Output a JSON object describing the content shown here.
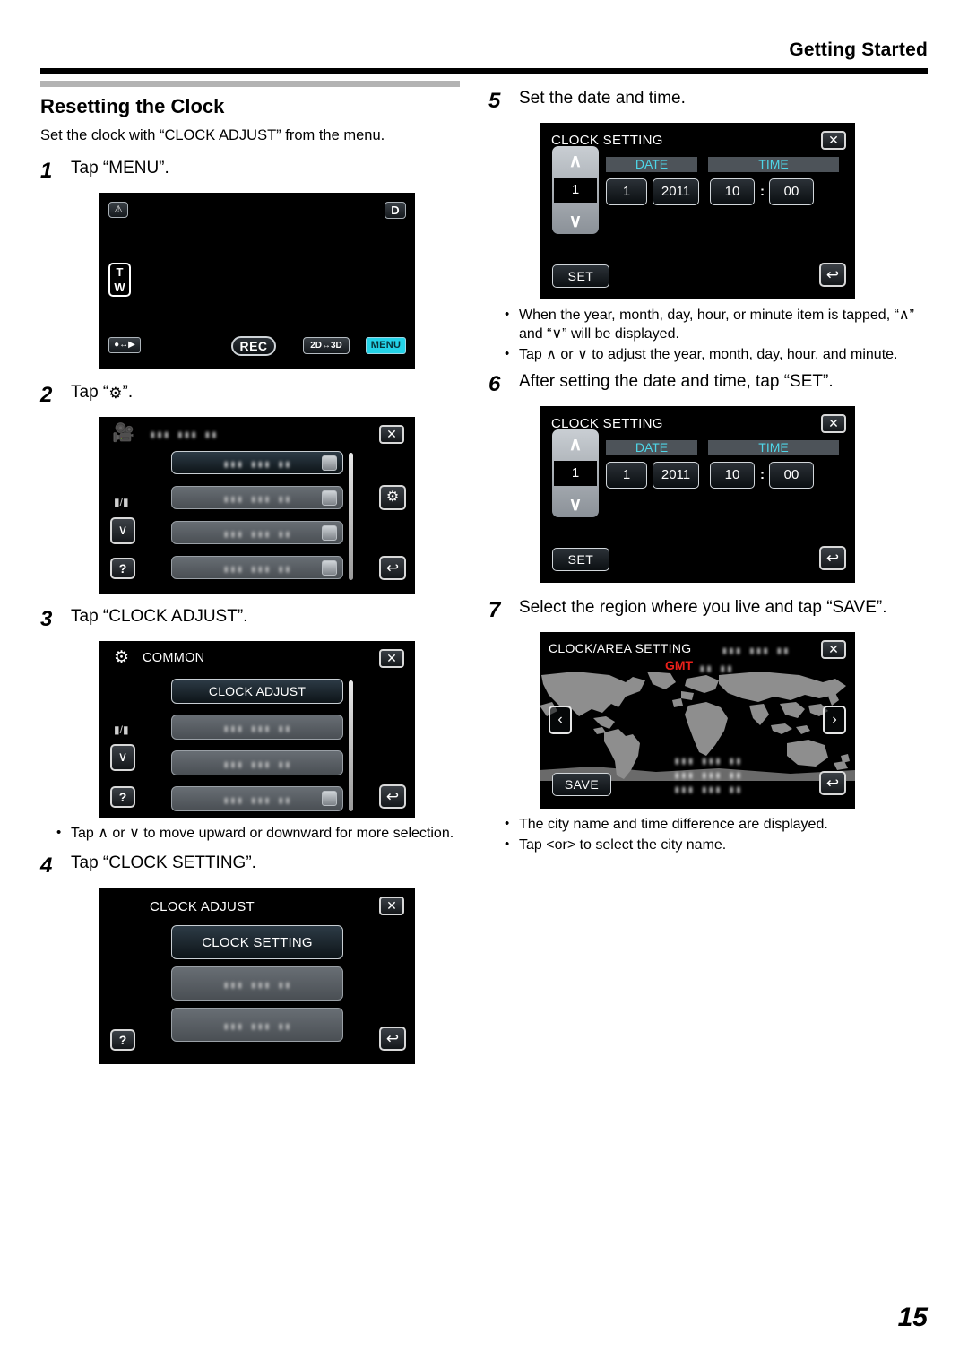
{
  "header": {
    "title": "Getting Started"
  },
  "page_number": "15",
  "section": {
    "title": "Resetting the Clock",
    "lead": "Set the clock with “CLOCK ADJUST” from the menu."
  },
  "steps": [
    {
      "num": "1",
      "text": "Tap “MENU”."
    },
    {
      "num": "2",
      "text_before": "Tap “",
      "icon": "gear-icon",
      "text_after": "”."
    },
    {
      "num": "3",
      "text": "Tap “CLOCK ADJUST”."
    },
    {
      "num": "4",
      "text": "Tap “CLOCK SETTING”."
    },
    {
      "num": "5",
      "text": "Set the date and time."
    },
    {
      "num": "6",
      "text": "After setting the date and time, tap “SET”."
    },
    {
      "num": "7",
      "text": "Select the region where you live and tap “SAVE”."
    }
  ],
  "notes": {
    "step3": [
      "Tap ∧ or ∨ to move upward or downward for more selection."
    ],
    "step5": [
      "When the year, month, day, hour, or minute item is tapped, “∧” and “∨” will be displayed.",
      "Tap ∧ or ∨ to adjust the year, month, day, hour, and minute."
    ],
    "step7": [
      "The city name and time difference are displayed.",
      "Tap <or> to select the city name."
    ]
  },
  "screens": {
    "record": {
      "warning_badge": "⚠",
      "d_badge": "D",
      "zoom_t": "T",
      "zoom_w": "W",
      "mode_switch": "●↔▶",
      "rec_label": "REC",
      "label_2d3d": "2D↔3D",
      "menu_label": "MENU"
    },
    "menu_video": {
      "icon": "camcorder-icon",
      "title_placeholder": "▮▮▮ ▮▮▮ ▮▮",
      "rows": [
        {
          "label": "▮▮▮ ▮▮▮ ▮▮",
          "selected": true,
          "has_switch": true
        },
        {
          "label": "▮▮▮ ▮▮▮ ▮▮",
          "selected": false,
          "has_switch": true
        },
        {
          "label": "▮▮▮ ▮▮▮ ▮▮",
          "selected": false,
          "has_switch": true
        },
        {
          "label": "▮▮▮ ▮▮▮ ▮▮",
          "selected": false,
          "has_switch": true
        }
      ],
      "close": "✕",
      "gear": "⚙",
      "down": "∨",
      "help": "?",
      "back": "↩",
      "media_icon": "▮/▮"
    },
    "menu_common": {
      "icon": "gear-icon",
      "title": "COMMON",
      "rows": [
        {
          "label": "CLOCK ADJUST",
          "selected": true,
          "has_switch": false
        },
        {
          "label": "▮▮▮ ▮▮▮ ▮▮",
          "selected": false,
          "has_switch": false
        },
        {
          "label": "▮▮▮ ▮▮▮ ▮▮",
          "selected": false,
          "has_switch": false
        },
        {
          "label": "▮▮▮ ▮▮▮ ▮▮",
          "selected": false,
          "has_switch": true
        }
      ],
      "close": "✕",
      "down": "∨",
      "help": "?",
      "back": "↩",
      "media_icon": "▮/▮"
    },
    "clock_adjust": {
      "title": "CLOCK ADJUST",
      "rows": [
        {
          "label": "CLOCK SETTING",
          "selected": true
        },
        {
          "label": "▮▮▮ ▮▮▮ ▮▮",
          "selected": false
        },
        {
          "label": "▮▮▮ ▮▮▮ ▮▮",
          "selected": false
        }
      ],
      "close": "✕",
      "help": "?",
      "back": "↩"
    },
    "clock_setting": {
      "title": "CLOCK SETTING",
      "date_header": "DATE",
      "time_header": "TIME",
      "spinner_value": "1",
      "spinner_up": "∧",
      "spinner_down": "∨",
      "month": "1",
      "year": "2011",
      "hour": "10",
      "colon": ":",
      "minute": "00",
      "set_label": "SET",
      "close": "✕",
      "back": "↩"
    },
    "clock_area": {
      "title": "CLOCK/AREA SETTING",
      "title_placeholder": "▮▮▮ ▮▮▮ ▮▮",
      "gmt_label": "GMT",
      "gmt_value": "▮▮ ▮▮",
      "city_lines": [
        "▮▮▮ ▮▮▮ ▮▮",
        "▮▮▮ ▮▮▮ ▮▮",
        "▮▮▮ ▮▮▮ ▮▮"
      ],
      "prev": "‹",
      "next": "›",
      "save_label": "SAVE",
      "close": "✕",
      "back": "↩"
    }
  },
  "colors": {
    "accent_cyan": "#23d3e8",
    "label_cyan": "#4fd6e8",
    "gmt_red": "#e8201a",
    "rule": "#000000",
    "section_bar": "#b3b3b3"
  }
}
